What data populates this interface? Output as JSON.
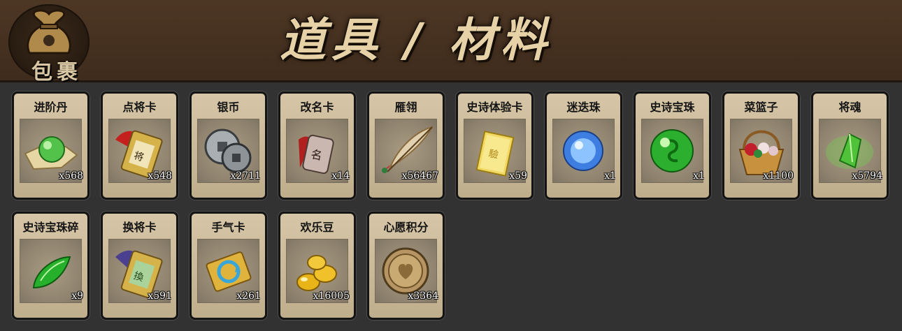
{
  "header": {
    "bag_label": "包裹",
    "bag_icon": "money-bag-icon",
    "title": "道具 / 材料"
  },
  "items": [
    {
      "name": "进阶丹",
      "count": "x568",
      "icon": "green-pill-on-cloth-icon"
    },
    {
      "name": "点将卡",
      "count": "x548",
      "icon": "general-token-card-icon"
    },
    {
      "name": "银币",
      "count": "x2711",
      "icon": "silver-coins-icon"
    },
    {
      "name": "改名卡",
      "count": "x14",
      "icon": "rename-scroll-card-icon"
    },
    {
      "name": "雁翎",
      "count": "x56467",
      "icon": "feather-quill-icon"
    },
    {
      "name": "史诗体验卡",
      "count": "x59",
      "icon": "gold-card-icon"
    },
    {
      "name": "迷迭珠",
      "count": "x1",
      "icon": "blue-orb-icon"
    },
    {
      "name": "史诗宝珠",
      "count": "x1",
      "icon": "green-orb-icon"
    },
    {
      "name": "菜篮子",
      "count": "x1100",
      "icon": "flower-basket-icon"
    },
    {
      "name": "将魂",
      "count": "x5794",
      "icon": "green-crystal-icon"
    },
    {
      "name": "史诗宝珠碎",
      "count": "x9",
      "icon": "green-shard-icon"
    },
    {
      "name": "换将卡",
      "count": "x591",
      "icon": "swap-general-token-icon"
    },
    {
      "name": "手气卡",
      "count": "x261",
      "icon": "refresh-card-icon"
    },
    {
      "name": "欢乐豆",
      "count": "x16005",
      "icon": "gold-beans-icon"
    },
    {
      "name": "心愿积分",
      "count": "x3364",
      "icon": "heart-coin-icon"
    }
  ]
}
